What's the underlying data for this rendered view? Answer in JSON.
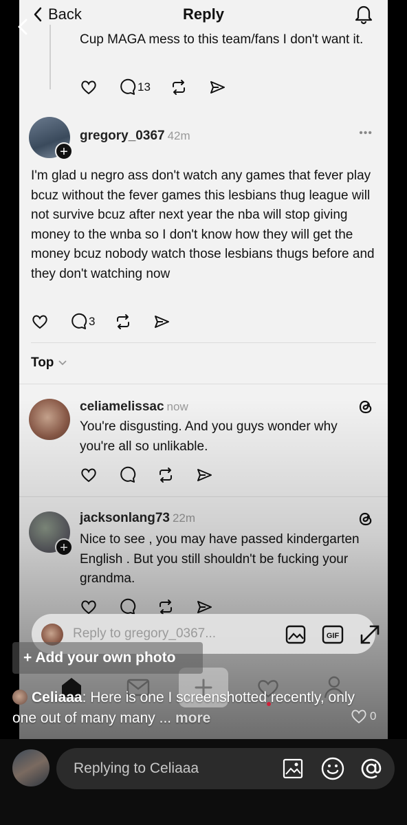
{
  "header": {
    "back_label": "Back",
    "title": "Reply"
  },
  "parent_post": {
    "text": "Cup MAGA mess to this team/fans I don't want it.",
    "reply_count": "13"
  },
  "main_post": {
    "username": "gregory_0367",
    "time": "42m",
    "more": "•••",
    "text": "I'm glad u negro ass don't watch any games that fever play bcuz without the fever games this lesbians thug league will not survive bcuz after next year the nba will stop giving money to the wnba so I don't know how they will get the money bcuz nobody watch those lesbians thugs before and they don't watching now",
    "reply_count": "3"
  },
  "sort": {
    "label": "Top"
  },
  "replies": [
    {
      "username": "celiamelissac",
      "time": "now",
      "text": "You're disgusting. And you guys wonder why you're all so unlikable."
    },
    {
      "username": "jacksonlang73",
      "time": "22m",
      "text": "Nice to see , you may have passed kindergarten English .  But you still shouldn't be fucking your grandma."
    }
  ],
  "reply_input": {
    "placeholder": "Reply to gregory_0367..."
  },
  "overlay": {
    "add_photo": "+ Add your own photo",
    "caption_user": "Celiaaa",
    "caption_text": ": Here is one I screenshotted recently, only one out of many many ... ",
    "caption_more": "more",
    "like_count": "0"
  },
  "dm_input": {
    "placeholder": "Replying to Celiaaa"
  },
  "icons": [
    "chevron-left-icon",
    "bell-icon",
    "heart-icon",
    "comment-icon",
    "repost-icon",
    "send-icon",
    "threads-icon",
    "image-icon",
    "gif-icon",
    "expand-icon",
    "home-icon",
    "mail-icon",
    "plus-icon",
    "profile-icon",
    "emoji-icon",
    "at-icon",
    "close-icon"
  ]
}
